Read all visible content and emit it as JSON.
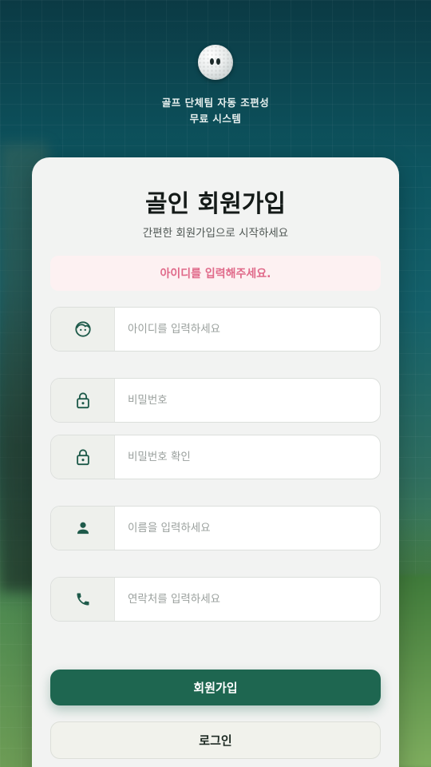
{
  "brand": {
    "line1": "골프 단체팀 자동 조편성",
    "line2": "무료 시스템"
  },
  "form": {
    "title": "골인 회원가입",
    "subtitle": "간편한 회원가입으로 시작하세요",
    "error_message": "아이디를 입력해주세요.",
    "fields": {
      "userid": {
        "placeholder": "아이디를 입력하세요",
        "icon": "face-icon"
      },
      "password": {
        "placeholder": "비밀번호",
        "icon": "lock-icon"
      },
      "password_confirm": {
        "placeholder": "비밀번호 확인",
        "icon": "lock-icon"
      },
      "name": {
        "placeholder": "이름을 입력하세요",
        "icon": "person-icon"
      },
      "phone": {
        "placeholder": "연락처를 입력하세요",
        "icon": "phone-icon"
      }
    },
    "signup_button": "회원가입",
    "login_button": "로그인"
  },
  "colors": {
    "primary": "#1e6650",
    "error_text": "#e06a8a",
    "error_bg": "#fdf1f2",
    "icon": "#1e5a4a"
  }
}
